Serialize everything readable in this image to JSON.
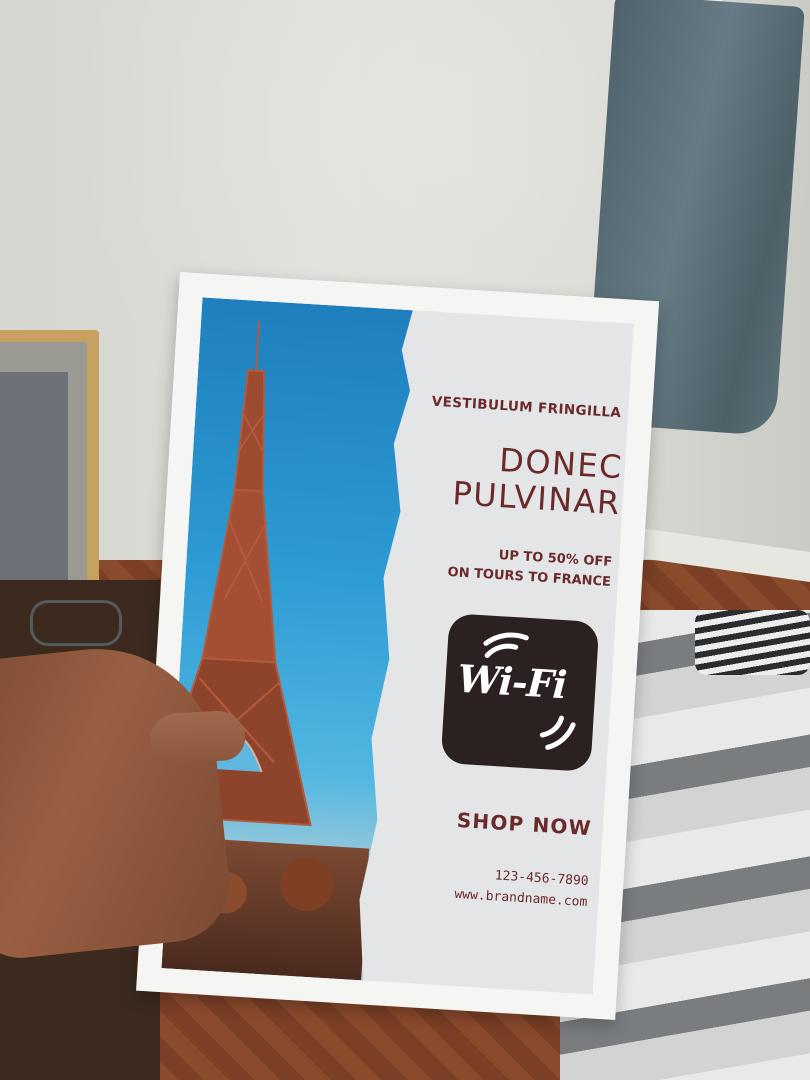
{
  "flyer": {
    "kicker": "VESTIBULUM FRINGILLA",
    "headline_line1": "DONEC",
    "headline_line2": "PULVINAR",
    "offer_line1": "UP TO 50% OFF",
    "offer_line2": "ON TOURS TO FRANCE",
    "logo_text": "Wi-Fi",
    "cta": "SHOP NOW",
    "phone": "123-456-7890",
    "website": "www.brandname.com"
  },
  "colors": {
    "text_accent": "#6b2a2a",
    "logo_bg": "#2a2120",
    "sky": "#2d9bd4"
  },
  "icons": [
    "wifi-logo-icon",
    "eiffel-tower-image"
  ]
}
